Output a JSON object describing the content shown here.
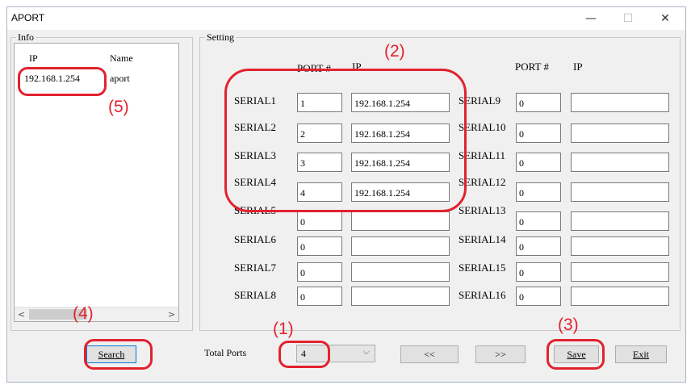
{
  "window": {
    "title": "APORT",
    "minimize": "—",
    "maximize": "☐",
    "close": "✕"
  },
  "info": {
    "group_label": "Info",
    "col_ip": "IP",
    "col_name": "Name",
    "rows": [
      {
        "ip": "192.168.1.254",
        "name": "aport"
      }
    ],
    "scroll_left": "<",
    "scroll_right": ">"
  },
  "setting": {
    "group_label": "Setting",
    "left_port_header": "PORT #",
    "left_ip_header": "IP",
    "right_port_header": "PORT #",
    "right_ip_header": "IP",
    "left": [
      {
        "label": "SERIAL1",
        "port": "1",
        "ip": "192.168.1.254"
      },
      {
        "label": "SERIAL2",
        "port": "2",
        "ip": "192.168.1.254"
      },
      {
        "label": "SERIAL3",
        "port": "3",
        "ip": "192.168.1.254"
      },
      {
        "label": "SERIAL4",
        "port": "4",
        "ip": "192.168.1.254"
      },
      {
        "label": "SERIAL5",
        "port": "0",
        "ip": ""
      },
      {
        "label": "SERIAL6",
        "port": "0",
        "ip": ""
      },
      {
        "label": "SERIAL7",
        "port": "0",
        "ip": ""
      },
      {
        "label": "SERIAL8",
        "port": "0",
        "ip": ""
      }
    ],
    "right": [
      {
        "label": "SERIAL9",
        "port": "0",
        "ip": ""
      },
      {
        "label": "SERIAL10",
        "port": "0",
        "ip": ""
      },
      {
        "label": "SERIAL11",
        "port": "0",
        "ip": ""
      },
      {
        "label": "SERIAL12",
        "port": "0",
        "ip": ""
      },
      {
        "label": "SERIAL13",
        "port": "0",
        "ip": ""
      },
      {
        "label": "SERIAL14",
        "port": "0",
        "ip": ""
      },
      {
        "label": "SERIAL15",
        "port": "0",
        "ip": ""
      },
      {
        "label": "SERIAL16",
        "port": "0",
        "ip": ""
      }
    ]
  },
  "bottom": {
    "search": "Search",
    "total_ports_label": "Total Ports",
    "total_ports_value": "4",
    "prev": "<<",
    "next": ">>",
    "save": "Save",
    "exit": "Exit"
  },
  "annotations": {
    "a1": "(1)",
    "a2": "(2)",
    "a3": "(3)",
    "a4": "(4)",
    "a5": "(5)",
    "color": "#e2222e"
  }
}
